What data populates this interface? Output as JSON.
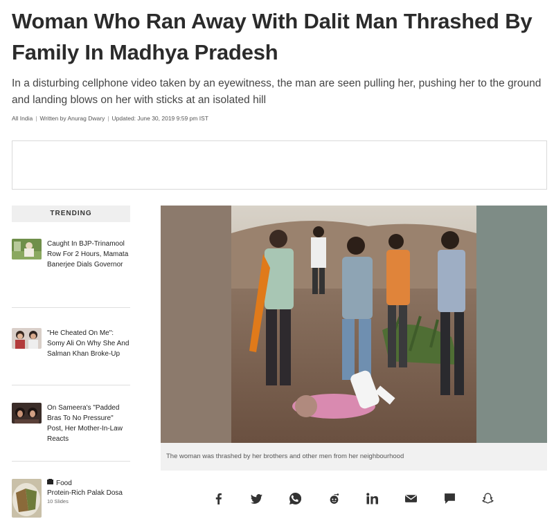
{
  "article": {
    "headline": "Woman Who Ran Away With Dalit Man Thrashed By Family In Madhya Pradesh",
    "subhead": "In a disturbing cellphone video taken by an eyewitness, the man are seen pulling her, pushing her to the ground and landing blows on her with sticks at an isolated hill",
    "meta": {
      "section": "All India",
      "author": "Written by Anurag Dwary",
      "updated": "Updated: June 30, 2019 9:59 pm IST"
    },
    "image_caption": "The woman was thrashed by her brothers and other men from her neighbourhood"
  },
  "trending": {
    "heading": "TRENDING",
    "items": [
      {
        "title": "Caught In BJP-Trinamool Row For 2 Hours, Mamata Banerjee Dials Governor"
      },
      {
        "title": "\"He Cheated On Me\": Somy Ali On Why She And Salman Khan Broke-Up"
      },
      {
        "title": "On Sameera's \"Padded Bras To No Pressure\" Post, Her Mother-In-Law Reacts"
      },
      {
        "category": "Food",
        "title": "Protein-Rich Palak Dosa",
        "slides": "10 Slides"
      }
    ]
  },
  "share": {
    "icons": [
      "facebook-icon",
      "twitter-icon",
      "whatsapp-icon",
      "reddit-icon",
      "linkedin-icon",
      "email-icon",
      "comment-icon",
      "snapchat-icon"
    ]
  },
  "colors": {
    "headline": "#2b2b2b",
    "caption_bg": "#f1f1f1",
    "trending_bg": "#efefef"
  }
}
